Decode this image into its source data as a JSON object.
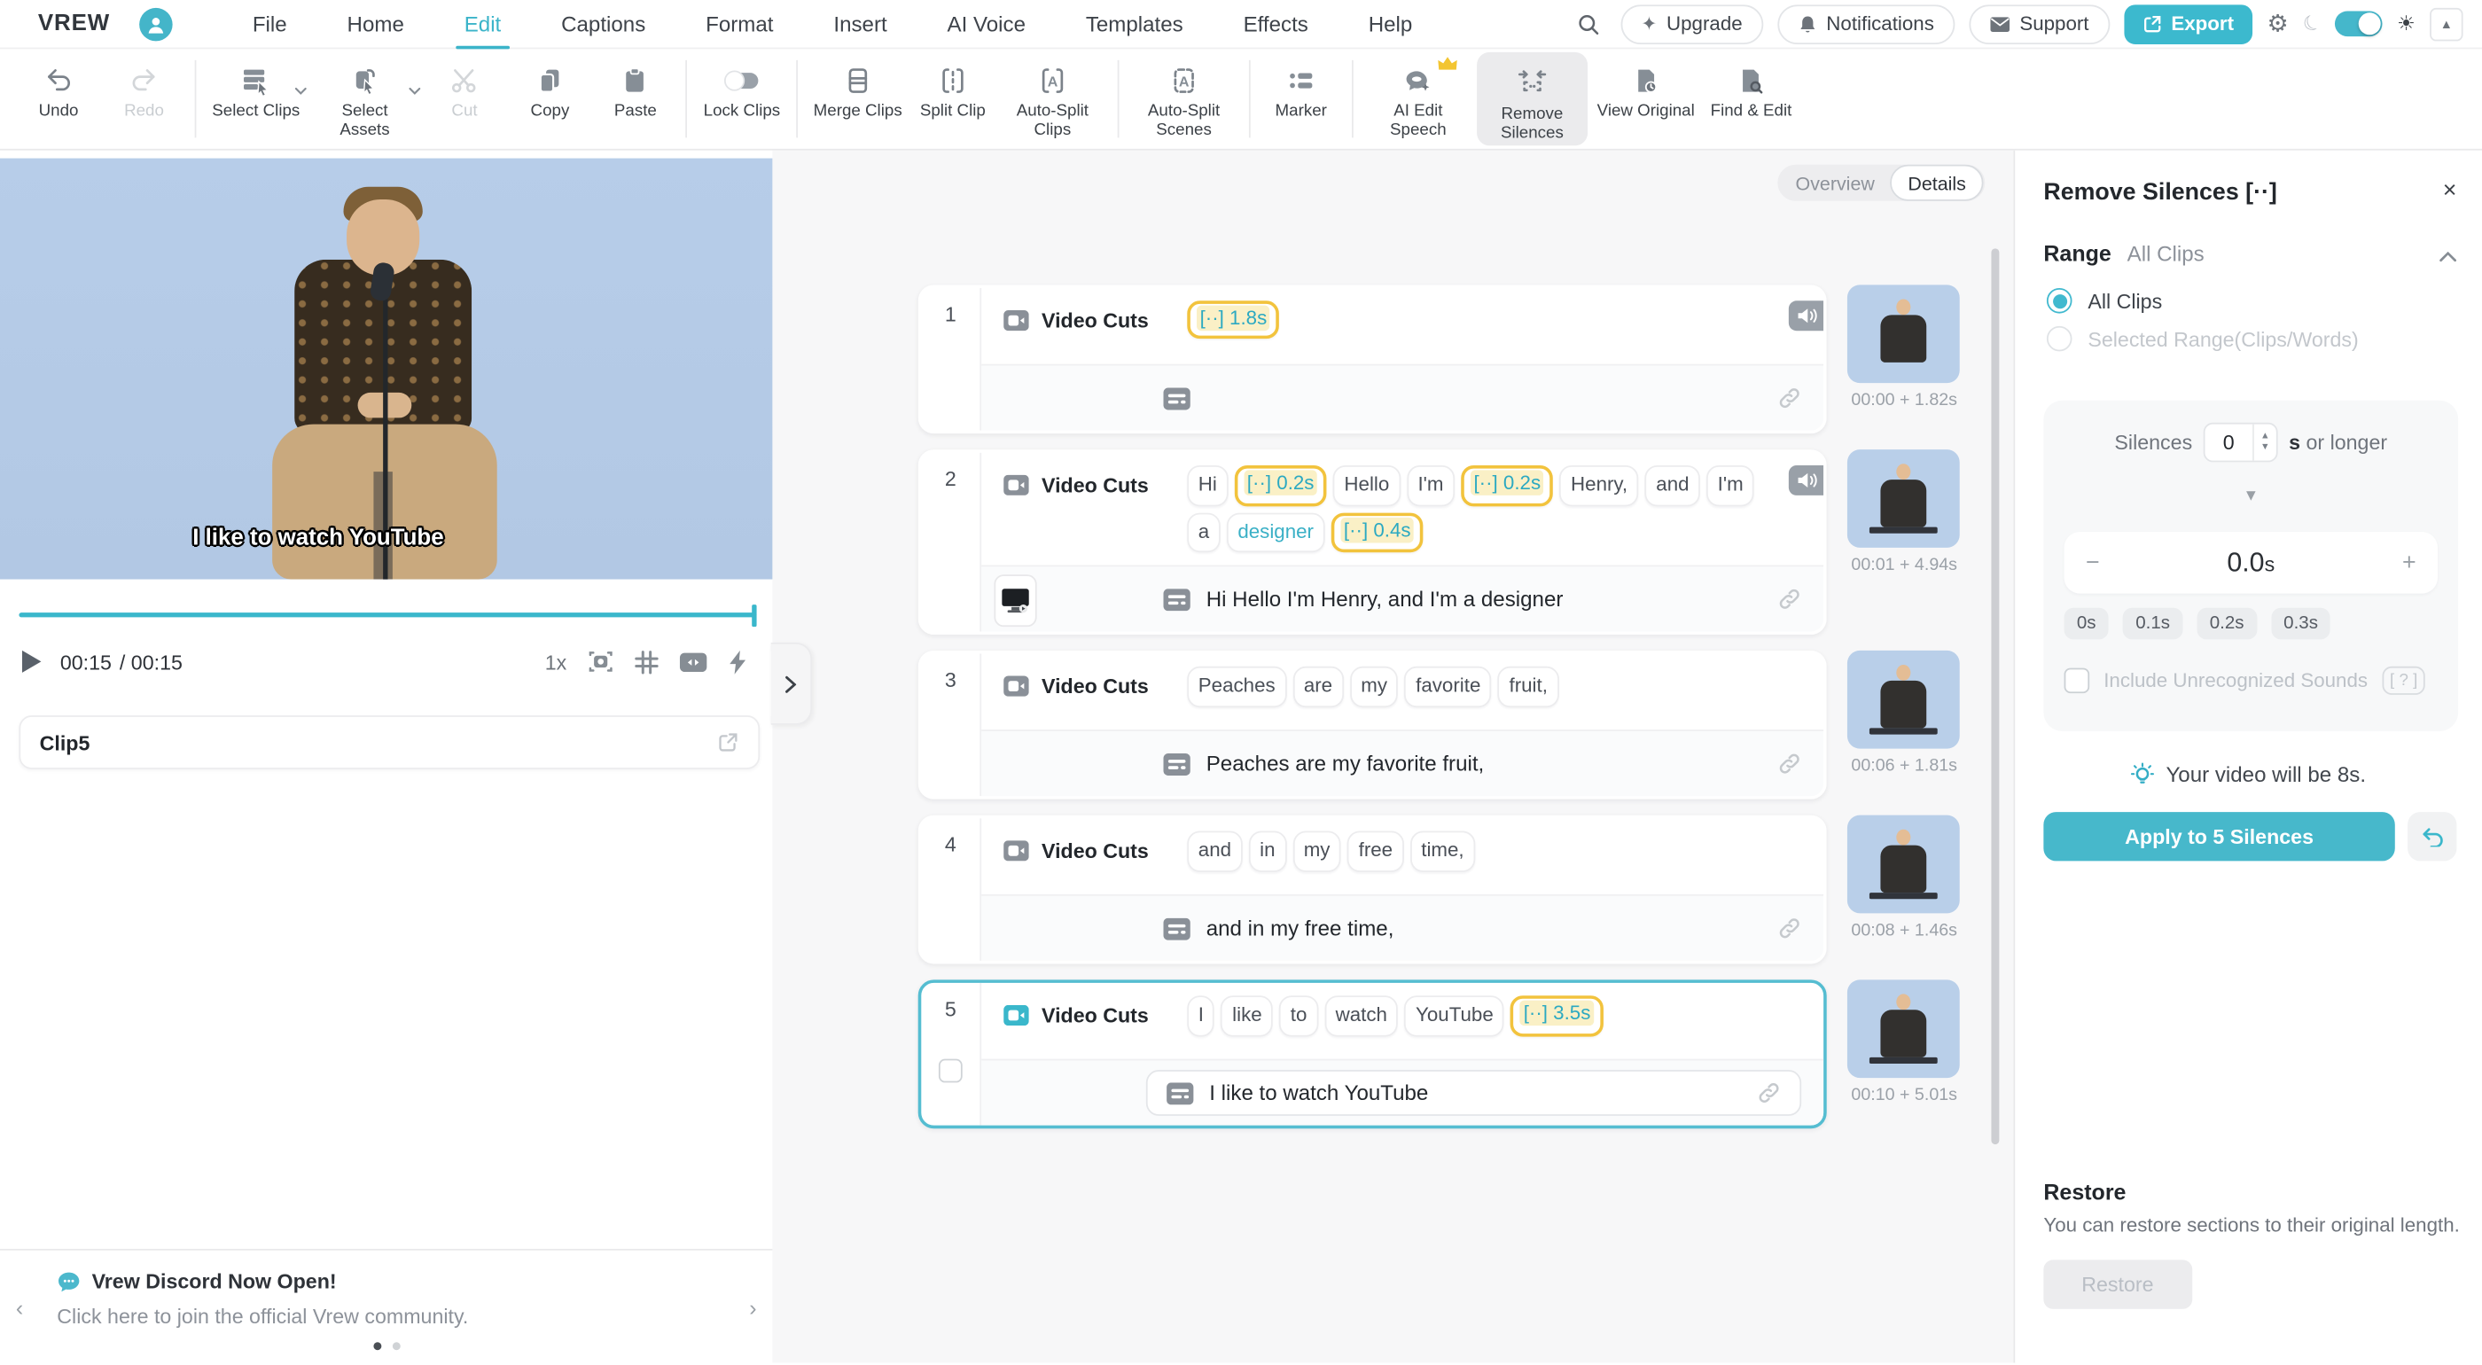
{
  "menu": {
    "logo": "VREW",
    "items": [
      "File",
      "Home",
      "Edit",
      "Captions",
      "Format",
      "Insert",
      "AI Voice",
      "Templates",
      "Effects",
      "Help"
    ],
    "active_index": 2,
    "upgrade": "Upgrade",
    "notifications": "Notifications",
    "support": "Support",
    "export": "Export"
  },
  "toolbar": {
    "items": [
      {
        "label": "Undo"
      },
      {
        "label": "Redo"
      },
      {
        "label": "Select Clips"
      },
      {
        "label": "Select Assets"
      },
      {
        "label": "Cut"
      },
      {
        "label": "Copy"
      },
      {
        "label": "Paste"
      },
      {
        "label": "Lock Clips"
      },
      {
        "label": "Merge Clips"
      },
      {
        "label": "Split Clip"
      },
      {
        "label": "Auto-Split Clips"
      },
      {
        "label": "Auto-Split Scenes"
      },
      {
        "label": "Marker"
      },
      {
        "label": "AI Edit Speech"
      },
      {
        "label": "Remove Silences"
      },
      {
        "label": "View Original"
      },
      {
        "label": "Find & Edit"
      }
    ]
  },
  "player": {
    "current_time": "00:15",
    "total_time": "/ 00:15",
    "speed": "1x",
    "clip_name": "Clip5",
    "video_caption": "I like to watch YouTube"
  },
  "tabs": {
    "overview": "Overview",
    "details": "Details"
  },
  "clip_list_label": "Video Cuts",
  "clips": [
    {
      "num": "1",
      "label": "Video Cuts",
      "words": [
        {
          "t": "[··] 1.8s",
          "silence": true
        }
      ],
      "caption": "",
      "time": "00:00 + 1.82s",
      "speaker": true,
      "media": false,
      "selected": false,
      "thumb_caption": false
    },
    {
      "num": "2",
      "label": "Video Cuts",
      "words": [
        {
          "t": "Hi"
        },
        {
          "t": "[··] 0.2s",
          "silence": true
        },
        {
          "t": "Hello"
        },
        {
          "t": "I'm"
        },
        {
          "t": "[··] 0.2s",
          "silence": true
        },
        {
          "t": "Henry,"
        },
        {
          "t": "and"
        },
        {
          "t": "I'm"
        },
        {
          "t": "a"
        },
        {
          "t": "designer",
          "highlight": true
        },
        {
          "t": "[··] 0.4s",
          "silence": true
        }
      ],
      "caption": "Hi Hello I'm Henry, and I'm a designer",
      "time": "00:01 + 4.94s",
      "speaker": true,
      "media": true,
      "selected": false,
      "thumb_caption": true
    },
    {
      "num": "3",
      "label": "Video Cuts",
      "words": [
        {
          "t": "Peaches"
        },
        {
          "t": "are"
        },
        {
          "t": "my"
        },
        {
          "t": "favorite"
        },
        {
          "t": "fruit,"
        }
      ],
      "caption": "Peaches are my favorite fruit,",
      "time": "00:06 + 1.81s",
      "speaker": false,
      "media": false,
      "selected": false,
      "thumb_caption": true
    },
    {
      "num": "4",
      "label": "Video Cuts",
      "words": [
        {
          "t": "and"
        },
        {
          "t": "in"
        },
        {
          "t": "my"
        },
        {
          "t": "free"
        },
        {
          "t": "time,"
        }
      ],
      "caption": "and in my free time,",
      "time": "00:08 + 1.46s",
      "speaker": false,
      "media": false,
      "selected": false,
      "thumb_caption": true
    },
    {
      "num": "5",
      "label": "Video Cuts",
      "words": [
        {
          "t": "I"
        },
        {
          "t": "like"
        },
        {
          "t": "to"
        },
        {
          "t": "watch"
        },
        {
          "t": "YouTube"
        },
        {
          "t": "[··] 3.5s",
          "silence": true
        }
      ],
      "caption": "I like to watch YouTube",
      "time": "00:10 + 5.01s",
      "speaker": false,
      "media": false,
      "selected": true,
      "thumb_caption": true,
      "boxed_caption": true,
      "checkbox": true
    }
  ],
  "panel": {
    "title": "Remove Silences [··]",
    "range_label": "Range",
    "range_value": "All Clips",
    "radio_all": "All Clips",
    "radio_selected": "Selected Range(Clips/Words)",
    "silences_label": "Silences",
    "silences_value": "0",
    "suffix_bold": "s",
    "suffix_rest": " or longer",
    "threshold_value": "0.0",
    "threshold_unit": "s",
    "minus": "−",
    "plus": "+",
    "presets": [
      "0s",
      "0.1s",
      "0.2s",
      "0.3s"
    ],
    "include_label": "Include Unrecognized Sounds",
    "include_badge": "[ ? ]",
    "tip": "Your video will be 8s.",
    "apply": "Apply to 5 Silences",
    "restore_title": "Restore",
    "restore_desc": "You can restore sections to their original length.",
    "restore_button": "Restore"
  },
  "banner": {
    "title": "Vrew Discord Now Open!",
    "subtitle": "Click here to join the official Vrew community."
  },
  "colors": {
    "accent": "#3ab7cb",
    "silence_border": "#f2c33d",
    "silence_highlight": "#faf0c6",
    "silence_text": "#2ba9c2",
    "selected_clip_border": "#55bdd1"
  }
}
